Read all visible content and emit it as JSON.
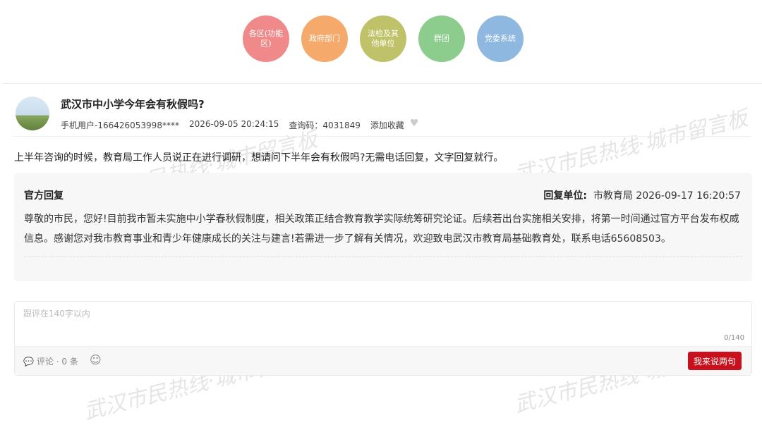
{
  "categories": [
    {
      "label": "各区(功能区)",
      "color": "#f08a8a"
    },
    {
      "label": "政府部门",
      "color": "#f5a96b"
    },
    {
      "label": "法检及其他单位",
      "color": "#c0c26a"
    },
    {
      "label": "群团",
      "color": "#8ccc8c"
    },
    {
      "label": "党委系统",
      "color": "#8eb8e0"
    }
  ],
  "watermark": "武汉市民热线·城市留言板",
  "post": {
    "title": "武汉市中小学今年会有秋假吗?",
    "user": "手机用户-166426053998****",
    "time": "2026-09-05 20:24:15",
    "query_code": "查询码：4031849",
    "favorite": "添加收藏",
    "content": "上半年咨询的时候，教育局工作人员说正在进行调研，想请问下半年会有秋假吗?无需电话回复，文字回复就行。"
  },
  "reply": {
    "label": "官方回复",
    "unit_label": "回复单位:",
    "unit": "市教育局",
    "time": "2026-09-17 16:20:57",
    "text": "尊敬的市民，您好!目前我市暂未实施中小学春秋假制度，相关政策正结合教育教学实际统筹研究论证。后续若出台实施相关安排，将第一时间通过官方平台发布权威信息。感谢您对我市教育事业和青少年健康成长的关注与建言!若需进一步了解有关情况，欢迎致电武汉市教育局基础教育处，联系电话65608503。"
  },
  "comment": {
    "placeholder": "跟评在140字以内",
    "counter": "0/140",
    "count_label": "评论 · 0 条",
    "submit": "我来说两句"
  }
}
